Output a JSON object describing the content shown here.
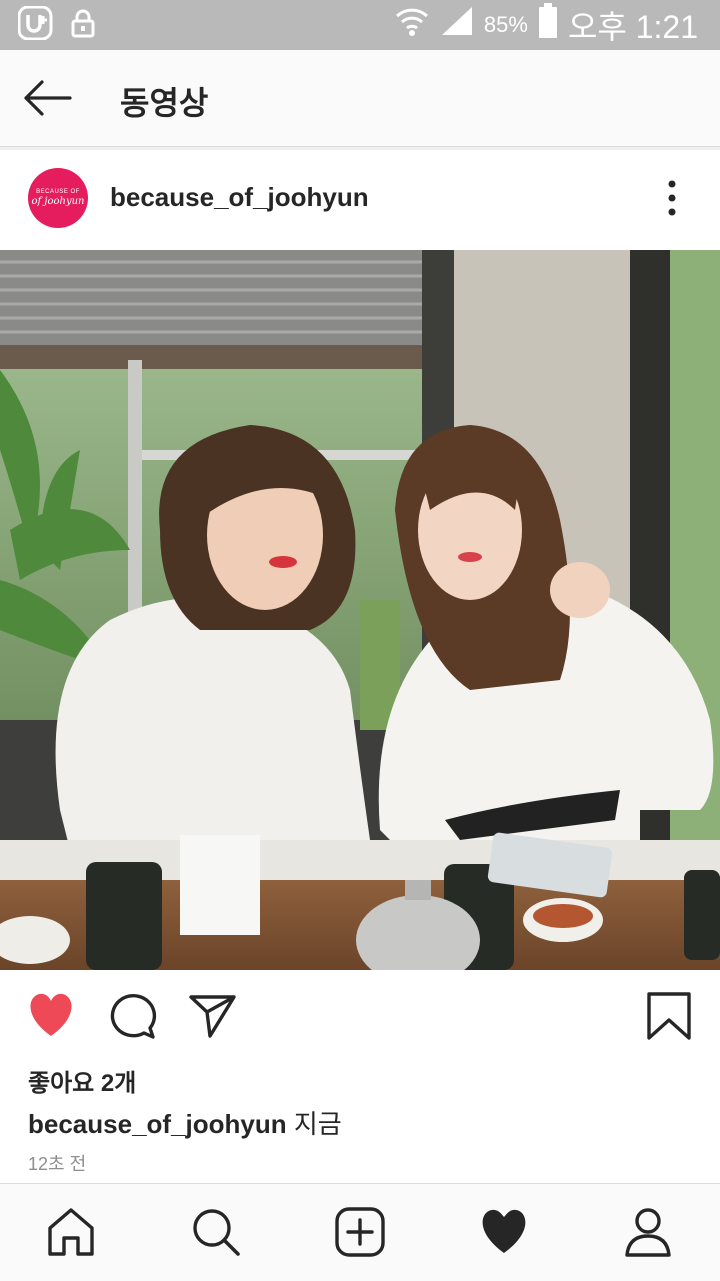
{
  "status_bar": {
    "left_icons": [
      "u-plus-icon",
      "lock-icon"
    ],
    "right_icons": [
      "wifi-icon",
      "signal-icon",
      "battery-icon"
    ],
    "battery_percent": "85%",
    "time": "오후 1:21"
  },
  "header": {
    "back_icon": "arrow-left-icon",
    "title": "동영상"
  },
  "post": {
    "username": "because_of_joohyun",
    "avatar": {
      "line1": "BECAUSE OF",
      "line2": "of joohyun",
      "color": "#e51d5e"
    },
    "more_icon": "more-vertical-icon",
    "actions": {
      "like_icon": "heart-filled-icon",
      "comment_icon": "comment-icon",
      "share_icon": "send-icon",
      "save_icon": "bookmark-icon",
      "like_color": "#ed4956"
    },
    "likes_text": "좋아요 2개",
    "caption_user": "because_of_joohyun",
    "caption_text": " 지금",
    "time_ago": "12초 전"
  },
  "bottom_nav": {
    "items": [
      {
        "icon": "home-icon"
      },
      {
        "icon": "search-icon"
      },
      {
        "icon": "add-post-icon"
      },
      {
        "icon": "activity-heart-icon"
      },
      {
        "icon": "profile-icon"
      }
    ]
  }
}
